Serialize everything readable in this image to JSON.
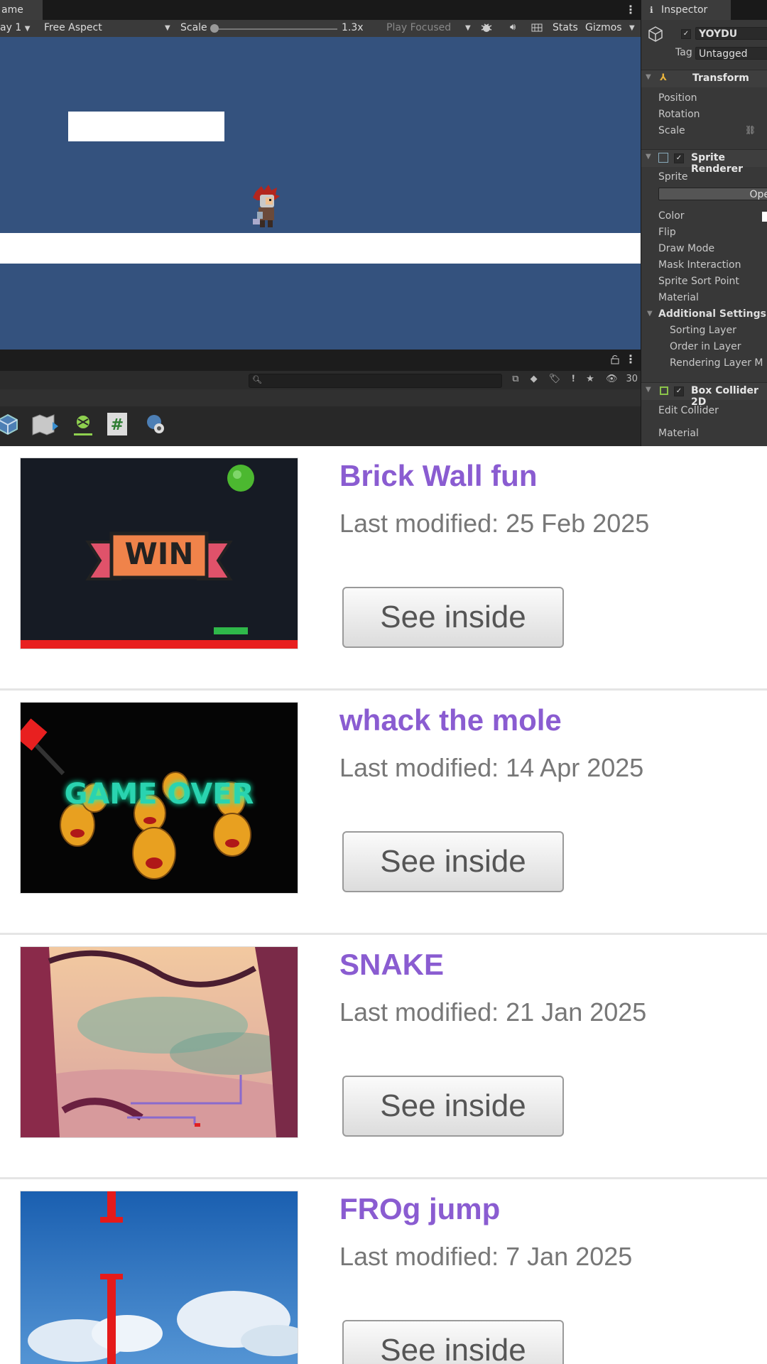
{
  "game_tab": {
    "label": "ame"
  },
  "game_toolbar": {
    "display": "ay 1",
    "aspect": "Free Aspect",
    "scale_label": "Scale",
    "scale_value": "1.3x",
    "play_mode": "Play Focused",
    "stats_label": "Stats",
    "gizmos_label": "Gizmos"
  },
  "project_toolbar": {
    "visible_count": "30"
  },
  "inspector": {
    "tab_label": "Inspector",
    "object_name": "YOYDU",
    "tag_label": "Tag",
    "tag_value": "Untagged",
    "transform": {
      "title": "Transform",
      "position": "Position",
      "rotation": "Rotation",
      "scale": "Scale"
    },
    "sprite_renderer": {
      "title": "Sprite Renderer",
      "sprite": "Sprite",
      "open_button": "Ope",
      "color": "Color",
      "flip": "Flip",
      "draw_mode": "Draw Mode",
      "mask_interaction": "Mask Interaction",
      "sprite_sort_point": "Sprite Sort Point",
      "material": "Material"
    },
    "additional_settings": {
      "title": "Additional Settings",
      "sorting_layer": "Sorting Layer",
      "order_in_layer": "Order in Layer",
      "rendering_layer": "Rendering Layer M"
    },
    "box_collider": {
      "title": "Box Collider 2D",
      "edit_collider": "Edit Collider",
      "material": "Material"
    }
  },
  "projects": [
    {
      "title": "Brick Wall fun",
      "modified": "Last modified: 25 Feb 2025",
      "button": "See inside",
      "thumb_text": "WIN"
    },
    {
      "title": "whack the mole",
      "modified": "Last modified: 14 Apr 2025",
      "button": "See inside",
      "thumb_text": "GAME OVER"
    },
    {
      "title": "SNAKE",
      "modified": "Last modified: 21 Jan 2025",
      "button": "See inside"
    },
    {
      "title": "FROg jump",
      "modified": "Last modified: 7 Jan 2025",
      "button": "See inside"
    }
  ],
  "colors": {
    "scene_bg": "#34527e",
    "title_purple": "#8a5cd1",
    "editor_dark": "#282828"
  }
}
